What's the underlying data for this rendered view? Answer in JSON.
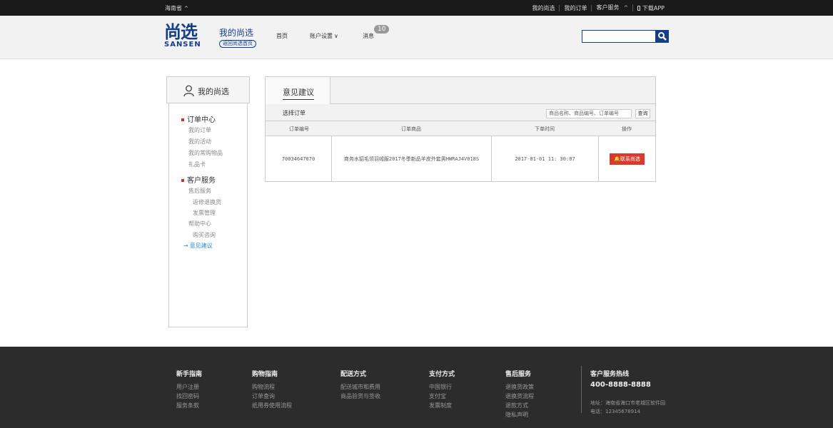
{
  "topbar": {
    "region": "海南省",
    "links": [
      "我的尚选",
      "我的订单",
      "客户服务",
      "下载APP"
    ]
  },
  "header": {
    "logo_cn": "尚选",
    "logo_en": "SANSEN",
    "page_title": "我的尚选",
    "back_home": "返回尚选首页",
    "nav_home": "首页",
    "nav_account": "账户设置",
    "nav_messages": "消息",
    "message_count": "10",
    "search_value": ""
  },
  "sidebar": {
    "title": "我的尚选",
    "section_orders": "订单中心",
    "order_items": [
      "我的订单",
      "我的活动",
      "我的常购物品",
      "礼品卡"
    ],
    "section_service": "客户服务",
    "after_sale": "售后服务",
    "after_sale_items": [
      "返修退换货",
      "发票管理"
    ],
    "help_center": "帮助中心",
    "help_items": [
      "购买咨询",
      "意见建议"
    ]
  },
  "main": {
    "tab_label": "意见建议",
    "select_order_label": "选择订单",
    "search_placeholder": "商品名称、商品编号、订单编号",
    "query_button": "查询",
    "columns": [
      "订单编号",
      "订单商品",
      "下单时间",
      "操作"
    ],
    "rows": [
      {
        "order_no": "70034647070",
        "product": "商务水貂毛领羽绒服2017冬季新品羊皮外套男HWRAJ4V018S",
        "time": "2017-01-01 11: 30:07",
        "action": "联系尚选"
      }
    ]
  },
  "footer": {
    "columns": [
      {
        "title": "新手指南",
        "items": [
          "用户注册",
          "找回密码",
          "服务条款"
        ]
      },
      {
        "title": "购物指南",
        "items": [
          "购物流程",
          "订单查询",
          "纸用券使用流程"
        ]
      },
      {
        "title": "配送方式",
        "items": [
          "配送城市和费用",
          "商品验货与签收"
        ]
      },
      {
        "title": "支付方式",
        "items": [
          "中国银行",
          "支付宝",
          "发票制度"
        ]
      },
      {
        "title": "售后服务",
        "items": [
          "退换货政策",
          "退换货流程",
          "退款方式",
          "隐私声明"
        ]
      }
    ],
    "hotline_title": "客户服务热线",
    "hotline": "400-8888-8888",
    "address": "地址：海南省海口市老城区软件园",
    "phone": "电话：12345678914"
  },
  "colors": {
    "brand": "#143e8a",
    "accent_red": "#d83a2e",
    "active_link": "#2a8ad4"
  }
}
